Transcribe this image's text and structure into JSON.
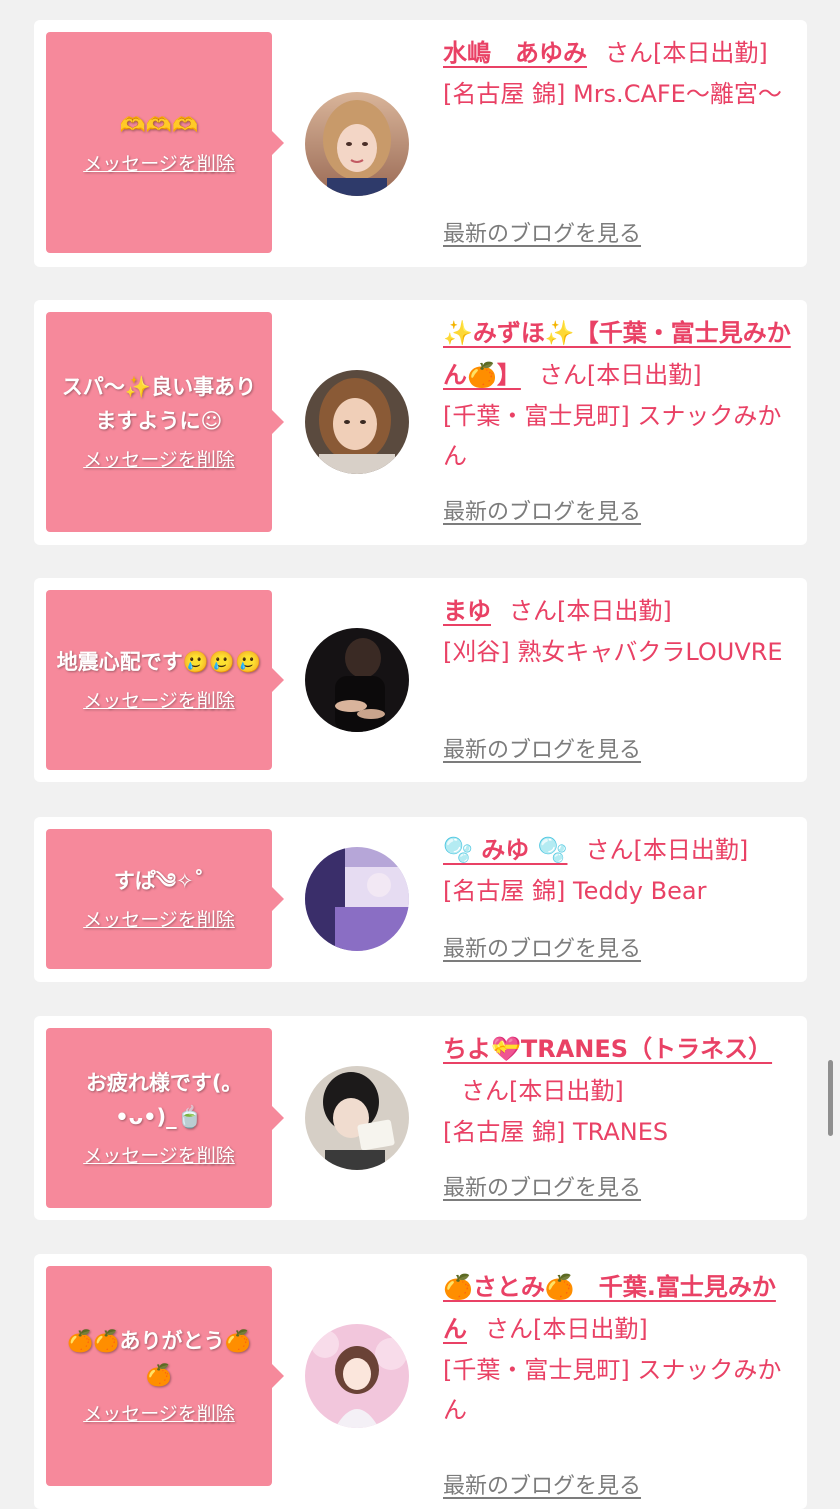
{
  "common": {
    "delete_label": "メッセージを削除",
    "blog_label": "最新のブログを見る"
  },
  "cards": [
    {
      "message": "🫶🫶🫶",
      "name": "水嶋　あゆみ",
      "suffix": "さん[本日出勤]",
      "shop": "[名古屋 錦] Mrs.CAFE〜離宮〜",
      "avatar": "avatar-portrait-blonde-woman"
    },
    {
      "message": "スパ〜✨良い事ありますように☺",
      "name": "✨みずほ✨【千葉・富士見みかん🍊】",
      "suffix": "さん[本日出勤]",
      "shop": "[千葉・富士見町] スナックみかん",
      "avatar": "avatar-portrait-woman-brown-hair"
    },
    {
      "message": "地震心配です🥲🥲🥲",
      "name": "まゆ",
      "suffix": "さん[本日出勤]",
      "shop": "[刈谷] 熟女キャバクラLOUVRE",
      "avatar": "avatar-dark-photo-woman"
    },
    {
      "message": "すぱ༄✧˚",
      "name": "🫧 みゆ 🫧",
      "suffix": "さん[本日出勤]",
      "shop": "[名古屋 錦] Teddy Bear",
      "avatar": "avatar-purple-blurred-photo"
    },
    {
      "message": "お疲れ様です(｡•ᴗ•)_🍵",
      "name": "ちよ💝TRANES（トラネス）",
      "suffix": "さん[本日出勤]",
      "shop": "[名古屋 錦] TRANES",
      "avatar": "avatar-woman-holding-card"
    },
    {
      "message": "🍊🍊ありがとう🍊🍊",
      "name": "🍊さとみ🍊　千葉.富士見みかん",
      "suffix": "さん[本日出勤]",
      "shop": "[千葉・富士見町] スナックみかん",
      "avatar": "avatar-illustration-cherry-blossom"
    }
  ],
  "colors": {
    "accent": "#e94165",
    "bubble": "#f6899b",
    "link_gray": "#7c7c7c",
    "background": "#f1f1f1"
  }
}
